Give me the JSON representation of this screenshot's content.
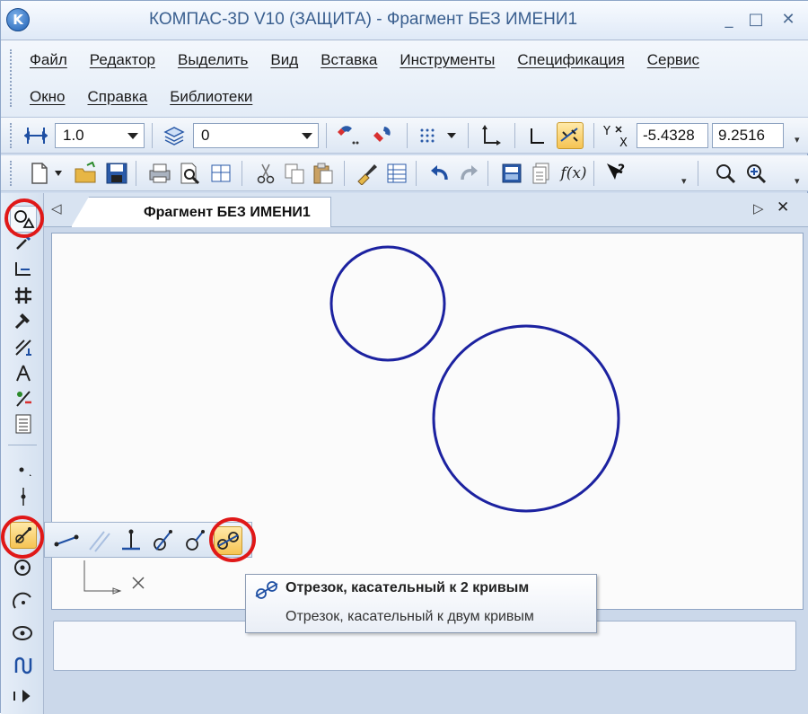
{
  "window": {
    "title": "КОМПАС-3D V10 (ЗАЩИТА) - Фрагмент БЕЗ ИМЕНИ1",
    "logo_letter": "K",
    "minimize_glyph": "▭",
    "maximize_glyph": "□",
    "close_glyph": "✕"
  },
  "menu": {
    "row1": [
      "Файл",
      "Редактор",
      "Выделить",
      "Вид",
      "Вставка",
      "Инструменты",
      "Спецификация",
      "Сервис"
    ],
    "row2": [
      "Окно",
      "Справка",
      "Библиотеки"
    ]
  },
  "toolbar1": {
    "step_value": "1.0",
    "layer_value": "0",
    "coord_x": "-5.4328",
    "coord_y": "9.2516",
    "coord_label": "Y X"
  },
  "toolbar2": {
    "fx_label": "f(x)"
  },
  "document": {
    "tab_label": "Фрагмент БЕЗ ИМЕНИ1",
    "tab_prev_glyph": "◁",
    "tab_next_glyph": "▷",
    "tab_close_glyph": "✕"
  },
  "tooltip": {
    "title": "Отрезок, касательный к 2 кривым",
    "description": "Отрезок, касательный к двум кривым"
  },
  "colors": {
    "circle_stroke": "#1c22a0",
    "highlight_ring": "#e01818",
    "active_button": "#f6c453"
  },
  "icons": {
    "flyout": [
      "segment-icon",
      "parallel-segment-icon",
      "perpendicular-segment-icon",
      "tangent-segment-icon",
      "tangent-segment-alt-icon",
      "tangent-two-curves-icon"
    ]
  }
}
